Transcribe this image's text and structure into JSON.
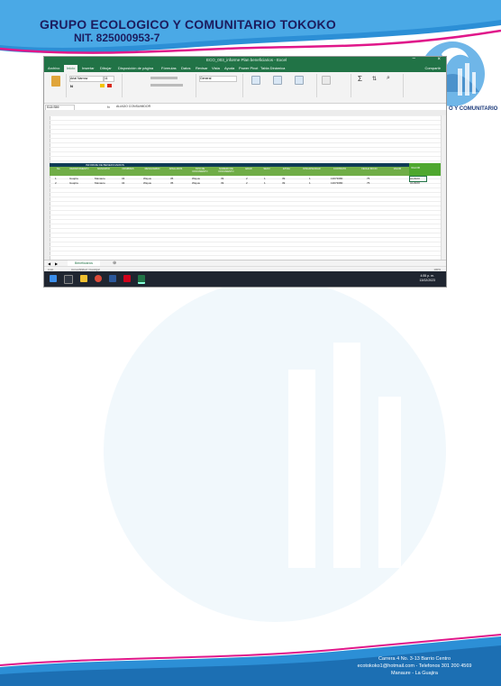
{
  "letterhead": {
    "org_name": "GRUPO ECOLOGICO Y COMUNITARIO TOKOKO",
    "nit": "NIT. 825000953-7",
    "logo_caption": "O Y COMUNITARIO",
    "footer_line1": "Carrera 4 No. 3-13 Barrio Centro",
    "footer_line2": "ecotokoko1@hotmail.com - Telefonos 301 200 4569",
    "footer_line3": "Manaure - La Guajira"
  },
  "excel": {
    "window_title": "ECO_003_informe Plan beneficiarios - Excel",
    "menu": [
      "Archivo",
      "Inicio",
      "Insertar",
      "Dibujar",
      "Disposición de página",
      "Fórmulas",
      "Datos",
      "Revisar",
      "Vista",
      "Ayuda",
      "Power Pivot",
      "Tabla Dinámica"
    ],
    "active_menu": "Inicio",
    "share_label": "Compartir",
    "font_name": "Arial Narrow",
    "font_size": "11",
    "number_format": "General",
    "name_box": "S13:S59",
    "formula_value": "ALIADO CONSUMIDOR",
    "table_title": "INFORME DE BENEFICIARIOS",
    "table_headers": [
      "No.",
      "DEPARTAMENTO",
      "MUNICIPIO",
      "NOMBRES",
      "RESGUARDO",
      "APELLIDOS",
      "TIPO DE DOCUMENTO",
      "NUMERO DE DOCUMENTO",
      "EDAD",
      "SEXO",
      "ETNIA",
      "DISCAPACIDAD",
      "CONTRATO",
      "FECHA INICIO",
      "VALOR"
    ],
    "rows": [
      [
        "1",
        "Guajira",
        "Manaure",
        "34",
        "Wayuu",
        "35",
        "Wayuu",
        "39",
        "2",
        "1",
        "39",
        "1",
        "13673680",
        "75",
        "ALIADO"
      ],
      [
        "2",
        "Guajira",
        "Manaure",
        "34",
        "Wayuu",
        "35",
        "Wayuu",
        "39",
        "2",
        "1",
        "39",
        "1",
        "13673680",
        "75",
        "ALIADO"
      ]
    ],
    "sheet_tab": "Beneficiarios",
    "status_left": "Listo",
    "status_accessibility": "Accesibilidad: investigar",
    "zoom": "100%",
    "clock_time": "4:55 p. m.",
    "clock_date": "13/02/2023"
  }
}
